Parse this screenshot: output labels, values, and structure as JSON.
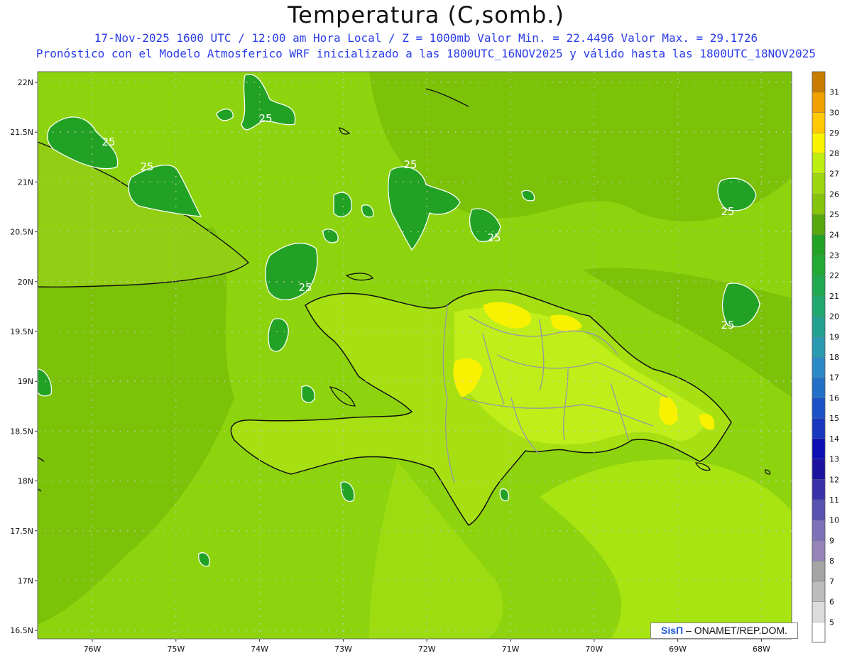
{
  "title": "Temperatura (C,somb.)",
  "subtitle_line1": "17-Nov-2025 1600 UTC / 12:00 am Hora Local / Z = 1000mb  Valor Min. = 22.4496  Valor Max. = 29.1726",
  "subtitle_line2": "Pronóstico con el Modelo Atmosferico WRF inicializado a las 1800UTC_16NOV2025 y válido hasta las  1800UTC_18NOV2025",
  "map": {
    "lon_range": [
      -76.65,
      -67.6
    ],
    "lat_range": [
      16.4,
      22.1
    ],
    "lat_ticks": [
      "22N",
      "21.5N",
      "21N",
      "20.5N",
      "20N",
      "19.5N",
      "19N",
      "18.5N",
      "18N",
      "17.5N",
      "17N",
      "16.5N"
    ],
    "lon_ticks": [
      "76W",
      "75W",
      "74W",
      "73W",
      "72W",
      "71W",
      "70W",
      "69W",
      "68W"
    ],
    "contour_label": "25"
  },
  "colorbar": {
    "levels": [
      "5",
      "6",
      "7",
      "8",
      "9",
      "10",
      "11",
      "12",
      "13",
      "14",
      "15",
      "16",
      "17",
      "18",
      "19",
      "20",
      "21",
      "22",
      "23",
      "24",
      "25",
      "26",
      "27",
      "28",
      "29",
      "30",
      "31"
    ],
    "colors": [
      "#ffffff",
      "#dcdcdc",
      "#bcbcbc",
      "#a5a5a5",
      "#9684b8",
      "#7d72b8",
      "#5a52b0",
      "#3a32a8",
      "#1c14a0",
      "#0c10b4",
      "#1838c0",
      "#1c52c8",
      "#2270c8",
      "#2a8ac8",
      "#2a9ab0",
      "#22a090",
      "#20a870",
      "#20a850",
      "#22a834",
      "#22a224",
      "#56a80e",
      "#86c40c",
      "#9cd610",
      "#bcee10",
      "#f8f400",
      "#ffc800",
      "#f0a000",
      "#c87c00"
    ]
  },
  "credit": {
    "brand": "SisΠ",
    "text": " – ONAMET/REP.DOM."
  }
}
